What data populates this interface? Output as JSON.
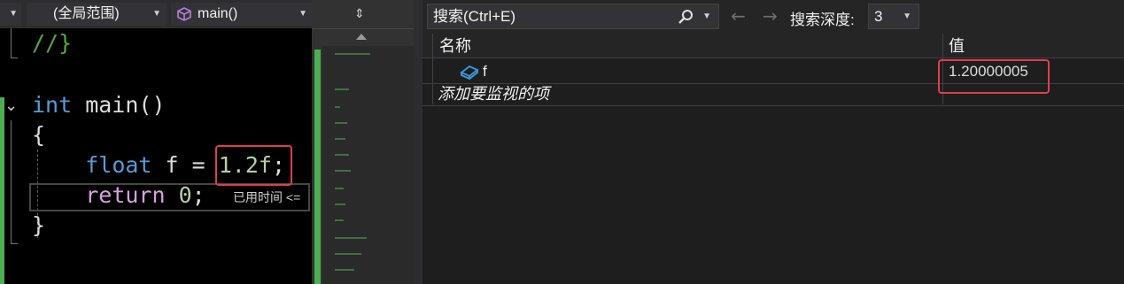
{
  "editor": {
    "scope_dropdown": "(全局范围)",
    "function_dropdown": "main()",
    "code_lines": [
      {
        "tokens": [
          {
            "text": "//}",
            "color": "#57a64a"
          }
        ]
      },
      {
        "tokens": []
      },
      {
        "tokens": [
          {
            "text": "int",
            "color": "#569cd6"
          },
          {
            "text": " main()",
            "color": "#dcdcdc"
          }
        ]
      },
      {
        "tokens": [
          {
            "text": "{",
            "color": "#dcdcdc"
          }
        ]
      },
      {
        "tokens": [
          {
            "text": "    ",
            "color": "#dcdcdc"
          },
          {
            "text": "float",
            "color": "#569cd6"
          },
          {
            "text": " f = ",
            "color": "#dcdcdc"
          },
          {
            "text": "1.2f",
            "color": "#b5cea8"
          },
          {
            "text": ";",
            "color": "#dcdcdc"
          }
        ]
      },
      {
        "tokens": [
          {
            "text": "    ",
            "color": "#dcdcdc"
          },
          {
            "text": "return",
            "color": "#d8a0df"
          },
          {
            "text": " ",
            "color": "#dcdcdc"
          },
          {
            "text": "0",
            "color": "#b5cea8"
          },
          {
            "text": ";",
            "color": "#dcdcdc"
          }
        ]
      },
      {
        "tokens": [
          {
            "text": "}",
            "color": "#dcdcdc"
          }
        ]
      }
    ],
    "elapsed_hint": "已用时间 <="
  },
  "watch": {
    "search_placeholder": "搜索(Ctrl+E)",
    "search_depth_label": "搜索深度:",
    "search_depth_value": "3",
    "columns": {
      "name": "名称",
      "value": "值"
    },
    "rows": [
      {
        "name": "f",
        "value": "1.20000005"
      }
    ],
    "add_item_text": "添加要监视的项"
  },
  "colors": {
    "highlight_box": "#e03e4e",
    "accent_green": "#4caf50"
  }
}
